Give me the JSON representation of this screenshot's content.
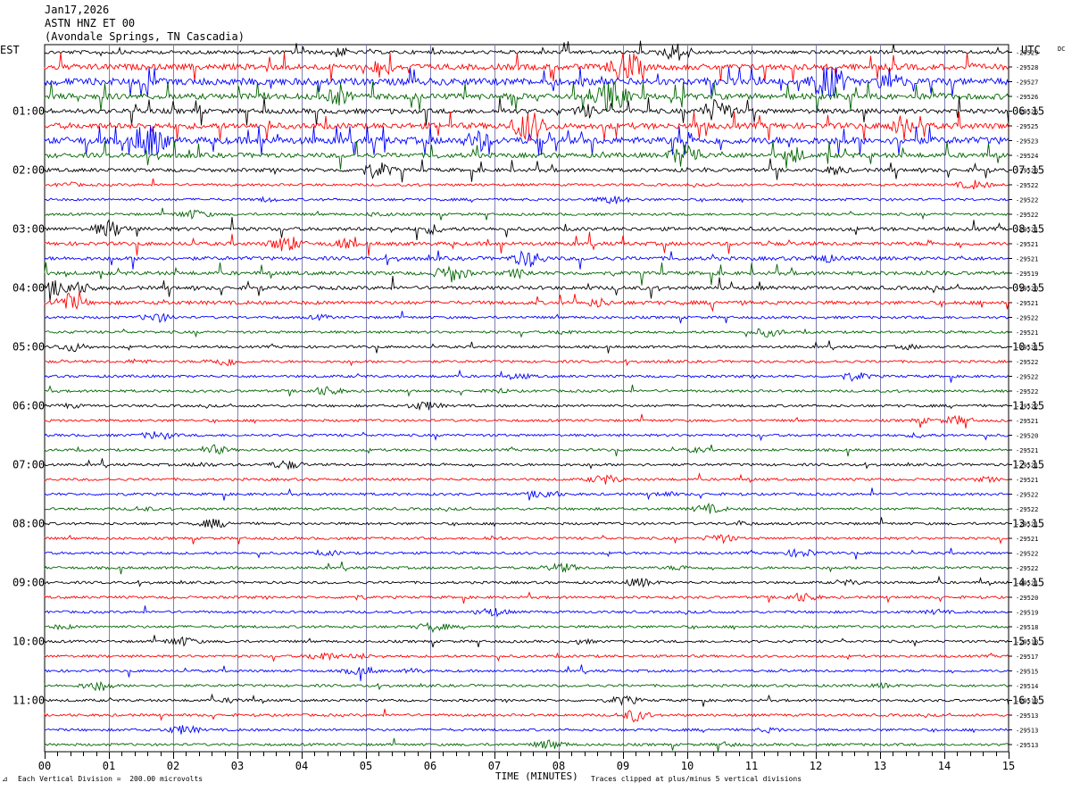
{
  "header": {
    "date": "Jan17,2026",
    "station": "ASTN HNZ ET 00",
    "location": "(Avondale Springs, TN Cascadia)"
  },
  "left_tz": "EST",
  "right_tz": "UTC",
  "footer": {
    "scale_note": "Each Vertical Division =  200.00 microvolts",
    "clip_note": "Traces clipped at plus/minus 5 vertical divisions",
    "mark": "⊿"
  },
  "colors": {
    "black": "#000000",
    "red": "#ff0000",
    "blue": "#0000ff",
    "green": "#006400",
    "grid": "#8080b0"
  },
  "chart_data": {
    "type": "line",
    "title": "",
    "xlabel": "TIME (MINUTES)",
    "ylabel": "",
    "x_ticks": [
      "00",
      "01",
      "02",
      "03",
      "04",
      "05",
      "06",
      "07",
      "08",
      "09",
      "10",
      "11",
      "12",
      "13",
      "14",
      "15"
    ],
    "xlim": [
      0,
      15
    ],
    "left_labels": [
      "",
      "01:00",
      "02:00",
      "03:00",
      "04:00",
      "05:00",
      "06:00",
      "07:00",
      "08:00",
      "09:00",
      "10:00",
      "11:00"
    ],
    "right_labels": [
      "",
      "06:15",
      "07:15",
      "08:15",
      "09:15",
      "10:15",
      "11:15",
      "12:15",
      "13:15",
      "14:15",
      "15:15",
      "16:15"
    ],
    "trace_colors": [
      "black",
      "red",
      "blue",
      "green"
    ],
    "trace_offsets": [
      "-29529",
      "-29528",
      "-29527",
      "-29526",
      "-29526",
      "-29525",
      "-29523",
      "-29524",
      "-29523",
      "-29522",
      "-29522",
      "-29522",
      "-29521",
      "-29521",
      "-29521",
      "-29519",
      "-29520",
      "-29521",
      "-29522",
      "-29521",
      "-29521",
      "-29522",
      "-29522",
      "-29522",
      "-29522",
      "-29521",
      "-29520",
      "-29521",
      "-29521",
      "-29521",
      "-29522",
      "-29522",
      "-29521",
      "-29521",
      "-29522",
      "-29522",
      "-29521",
      "-29520",
      "-29519",
      "-29518",
      "-29518",
      "-29517",
      "-29515",
      "-29514",
      "-29513",
      "-29513",
      "-29513",
      "-29513"
    ],
    "trace_activity": [
      2,
      4,
      5,
      4,
      3,
      4,
      5,
      3,
      2,
      1,
      1,
      1,
      2,
      2,
      2,
      2,
      2,
      2,
      1,
      1,
      1,
      1,
      1,
      1,
      1,
      1,
      1,
      1,
      1,
      1,
      1,
      1,
      1,
      1,
      1,
      1,
      1,
      1,
      1,
      1,
      1,
      1,
      1,
      1,
      1,
      1,
      1,
      1
    ],
    "top_right_tag": "DC"
  }
}
